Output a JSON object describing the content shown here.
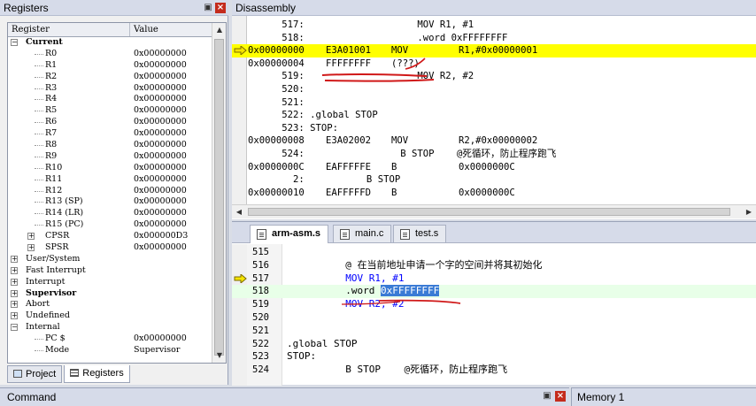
{
  "registers_panel": {
    "title": "Registers",
    "col_register": "Register",
    "col_value": "Value",
    "rows": [
      {
        "name": "Current",
        "value": "",
        "level": 0,
        "toggle": "−",
        "bold": true
      },
      {
        "name": "R0",
        "value": "0x00000000",
        "level": 1
      },
      {
        "name": "R1",
        "value": "0x00000000",
        "level": 1
      },
      {
        "name": "R2",
        "value": "0x00000000",
        "level": 1
      },
      {
        "name": "R3",
        "value": "0x00000000",
        "level": 1
      },
      {
        "name": "R4",
        "value": "0x00000000",
        "level": 1
      },
      {
        "name": "R5",
        "value": "0x00000000",
        "level": 1
      },
      {
        "name": "R6",
        "value": "0x00000000",
        "level": 1
      },
      {
        "name": "R7",
        "value": "0x00000000",
        "level": 1
      },
      {
        "name": "R8",
        "value": "0x00000000",
        "level": 1
      },
      {
        "name": "R9",
        "value": "0x00000000",
        "level": 1
      },
      {
        "name": "R10",
        "value": "0x00000000",
        "level": 1
      },
      {
        "name": "R11",
        "value": "0x00000000",
        "level": 1
      },
      {
        "name": "R12",
        "value": "0x00000000",
        "level": 1
      },
      {
        "name": "R13 (SP)",
        "value": "0x00000000",
        "level": 1
      },
      {
        "name": "R14 (LR)",
        "value": "0x00000000",
        "level": 1
      },
      {
        "name": "R15 (PC)",
        "value": "0x00000000",
        "level": 1
      },
      {
        "name": "CPSR",
        "value": "0x000000D3",
        "level": 1,
        "toggle": "+"
      },
      {
        "name": "SPSR",
        "value": "0x00000000",
        "level": 1,
        "toggle": "+"
      },
      {
        "name": "User/System",
        "value": "",
        "level": 0,
        "toggle": "+"
      },
      {
        "name": "Fast Interrupt",
        "value": "",
        "level": 0,
        "toggle": "+"
      },
      {
        "name": "Interrupt",
        "value": "",
        "level": 0,
        "toggle": "+"
      },
      {
        "name": "Supervisor",
        "value": "",
        "level": 0,
        "toggle": "+",
        "bold": true
      },
      {
        "name": "Abort",
        "value": "",
        "level": 0,
        "toggle": "+"
      },
      {
        "name": "Undefined",
        "value": "",
        "level": 0,
        "toggle": "+"
      },
      {
        "name": "Internal",
        "value": "",
        "level": 0,
        "toggle": "−"
      },
      {
        "name": "PC  $",
        "value": "0x00000000",
        "level": 1
      },
      {
        "name": "Mode",
        "value": "Supervisor",
        "level": 1
      }
    ],
    "tabs": [
      {
        "label": "Project",
        "active": false,
        "icon": "project-icon"
      },
      {
        "label": "Registers",
        "active": true,
        "icon": "registers-icon"
      }
    ]
  },
  "disassembly_panel": {
    "title": "Disassembly",
    "lines": [
      {
        "addr": "",
        "code": "",
        "mnem": "",
        "text": "      517:                    MOV R1, #1"
      },
      {
        "addr": "",
        "code": "",
        "mnem": "",
        "text": "      518:                    .word 0xFFFFFFFF"
      },
      {
        "addr": "0x00000000",
        "code": "E3A01001",
        "mnem": "MOV",
        "operands": "R1,#0x00000001",
        "current": true
      },
      {
        "addr": "0x00000004",
        "code": "FFFFFFFF",
        "mnem": "(???)",
        "operands": ""
      },
      {
        "addr": "",
        "code": "",
        "mnem": "",
        "text": "      519:                    MOV R2, #2"
      },
      {
        "addr": "",
        "code": "",
        "mnem": "",
        "text": "      520:"
      },
      {
        "addr": "",
        "code": "",
        "mnem": "",
        "text": "      521:"
      },
      {
        "addr": "",
        "code": "",
        "mnem": "",
        "text": "      522: .global STOP"
      },
      {
        "addr": "",
        "code": "",
        "mnem": "",
        "text": "      523: STOP:"
      },
      {
        "addr": "0x00000008",
        "code": "E3A02002",
        "mnem": "MOV",
        "operands": "R2,#0x00000002"
      },
      {
        "addr": "",
        "code": "",
        "mnem": "",
        "text": "      524:                 B STOP    @死循环，防止程序跑飞"
      },
      {
        "addr": "0x0000000C",
        "code": "EAFFFFFE",
        "mnem": "B",
        "operands": "0x0000000C"
      },
      {
        "addr": "",
        "code": "",
        "mnem": "",
        "text": "        2:           B STOP"
      },
      {
        "addr": "0x00000010",
        "code": "EAFFFFFD",
        "mnem": "B",
        "operands": "0x0000000C"
      }
    ]
  },
  "editor": {
    "tabs": [
      {
        "label": "arm-asm.s",
        "active": true
      },
      {
        "label": "main.c",
        "active": false
      },
      {
        "label": "test.s",
        "active": false
      }
    ],
    "lines": [
      {
        "num": "515",
        "code": ""
      },
      {
        "num": "516",
        "code": "          @ 在当前地址申请一个字的空间并将其初始化"
      },
      {
        "num": "517",
        "code": "          MOV R1, #1",
        "kw": "MOV",
        "current": true
      },
      {
        "num": "518",
        "code": "          .word ",
        "selected": "0xFFFFFFFF",
        "cursor": true
      },
      {
        "num": "519",
        "code": "          MOV R2, #2",
        "kw": "MOV"
      },
      {
        "num": "520",
        "code": ""
      },
      {
        "num": "521",
        "code": ""
      },
      {
        "num": "522",
        "code": ".global STOP"
      },
      {
        "num": "523",
        "code": "STOP:"
      },
      {
        "num": "524",
        "code": "          B STOP    @死循环，防止程序跑飞"
      }
    ]
  },
  "bottom": {
    "command_title": "Command",
    "memory_title": "Memory 1"
  },
  "colors": {
    "current_line": "#ffff00",
    "keyword": "#0000ff",
    "selection": "#3a7bd5",
    "annotation": "#d01818"
  }
}
